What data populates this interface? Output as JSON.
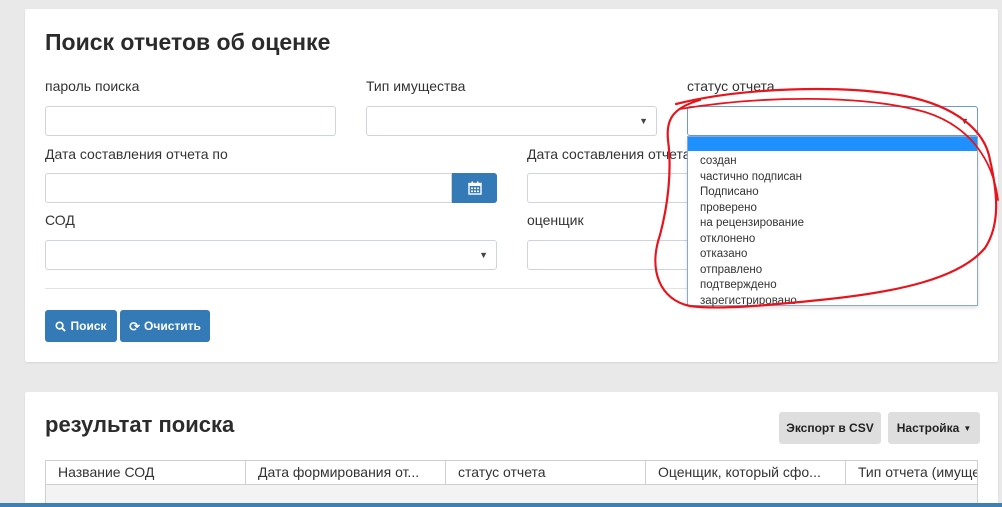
{
  "search": {
    "title": "Поиск отчетов об оценке",
    "fields": {
      "password_label": "пароль поиска",
      "property_type_label": "Тип имущества",
      "report_status_label": "статус отчета",
      "date_to_label": "Дата составления отчета по",
      "date_from_label": "Дата составления отчета",
      "sod_label": "СОД",
      "appraiser_label": "оценщик"
    },
    "status_options": [
      "",
      "создан",
      "частично подписан",
      "Подписано",
      "проверено",
      "на рецензирование",
      "отклонено",
      "отказано",
      "отправлено",
      "подтверждено",
      "зарегистрировано"
    ],
    "search_button": "Поиск",
    "clear_button": "Очистить"
  },
  "results": {
    "title": "результат поиска",
    "export_button": "Экспорт в CSV",
    "settings_button": "Настройка",
    "columns": [
      "Название СОД",
      "Дата формирования от...",
      "статус отчета",
      "Оценщик, который сфо...",
      "Тип отчета (имущест"
    ]
  },
  "colors": {
    "primary": "#337ab7",
    "highlight": "#1e90ff",
    "annotation": "#e8141c"
  }
}
